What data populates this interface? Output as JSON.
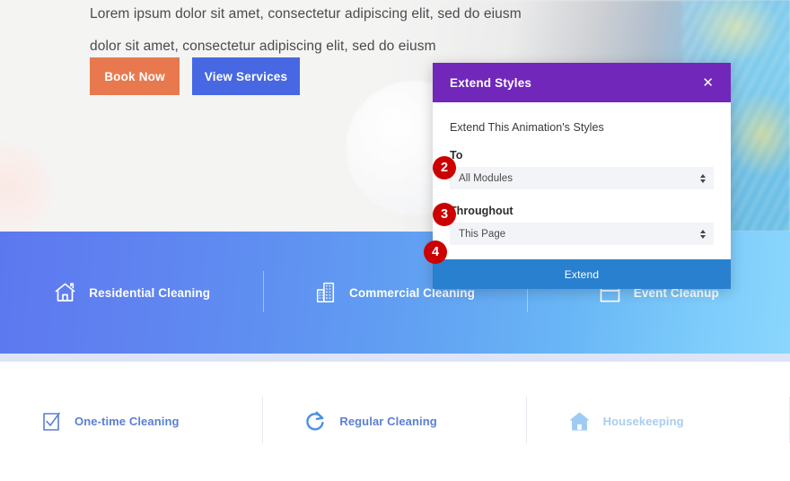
{
  "hero": {
    "paragraph_line_1": "Lorem ipsum dolor sit amet, consectetur adipiscing elit, sed do eiusm",
    "paragraph_line_2": "dolor sit amet, consectetur adipiscing elit, sed do eiusm",
    "buttons": {
      "primary_label": "Book Now",
      "primary_color": "#e8794f",
      "secondary_label": "View Services",
      "secondary_color": "#4768e2"
    }
  },
  "services_band": {
    "background_gradient_from": "#5d78ef",
    "background_gradient_to": "#8ad6fd",
    "items": [
      {
        "label": "Residential Cleaning",
        "icon": "house-icon"
      },
      {
        "label": "Commercial Cleaning",
        "icon": "office-building-icon"
      },
      {
        "label": "Event Cleanup",
        "icon": "calendar-icon"
      }
    ]
  },
  "features_band": {
    "label_color": "#5b7fd4",
    "faded_label_color": "#a9cdf1",
    "items": [
      {
        "label": "One-time Cleaning",
        "icon": "checkbox-checked-icon",
        "faded": false
      },
      {
        "label": "Regular Cleaning",
        "icon": "refresh-arrow-icon",
        "faded": false
      },
      {
        "label": "Housekeeping",
        "icon": "house-icon",
        "faded": true
      }
    ]
  },
  "modal": {
    "title": "Extend Styles",
    "header_color": "#7027ba",
    "close_label": "✕",
    "intro": "Extend This Animation's Styles",
    "fields": [
      {
        "label": "To",
        "value": "All Modules"
      },
      {
        "label": "Throughout",
        "value": "This Page"
      }
    ],
    "submit_label": "Extend",
    "submit_color": "#2980cf"
  },
  "step_badges": [
    {
      "number": "2"
    },
    {
      "number": "3"
    },
    {
      "number": "4"
    }
  ]
}
